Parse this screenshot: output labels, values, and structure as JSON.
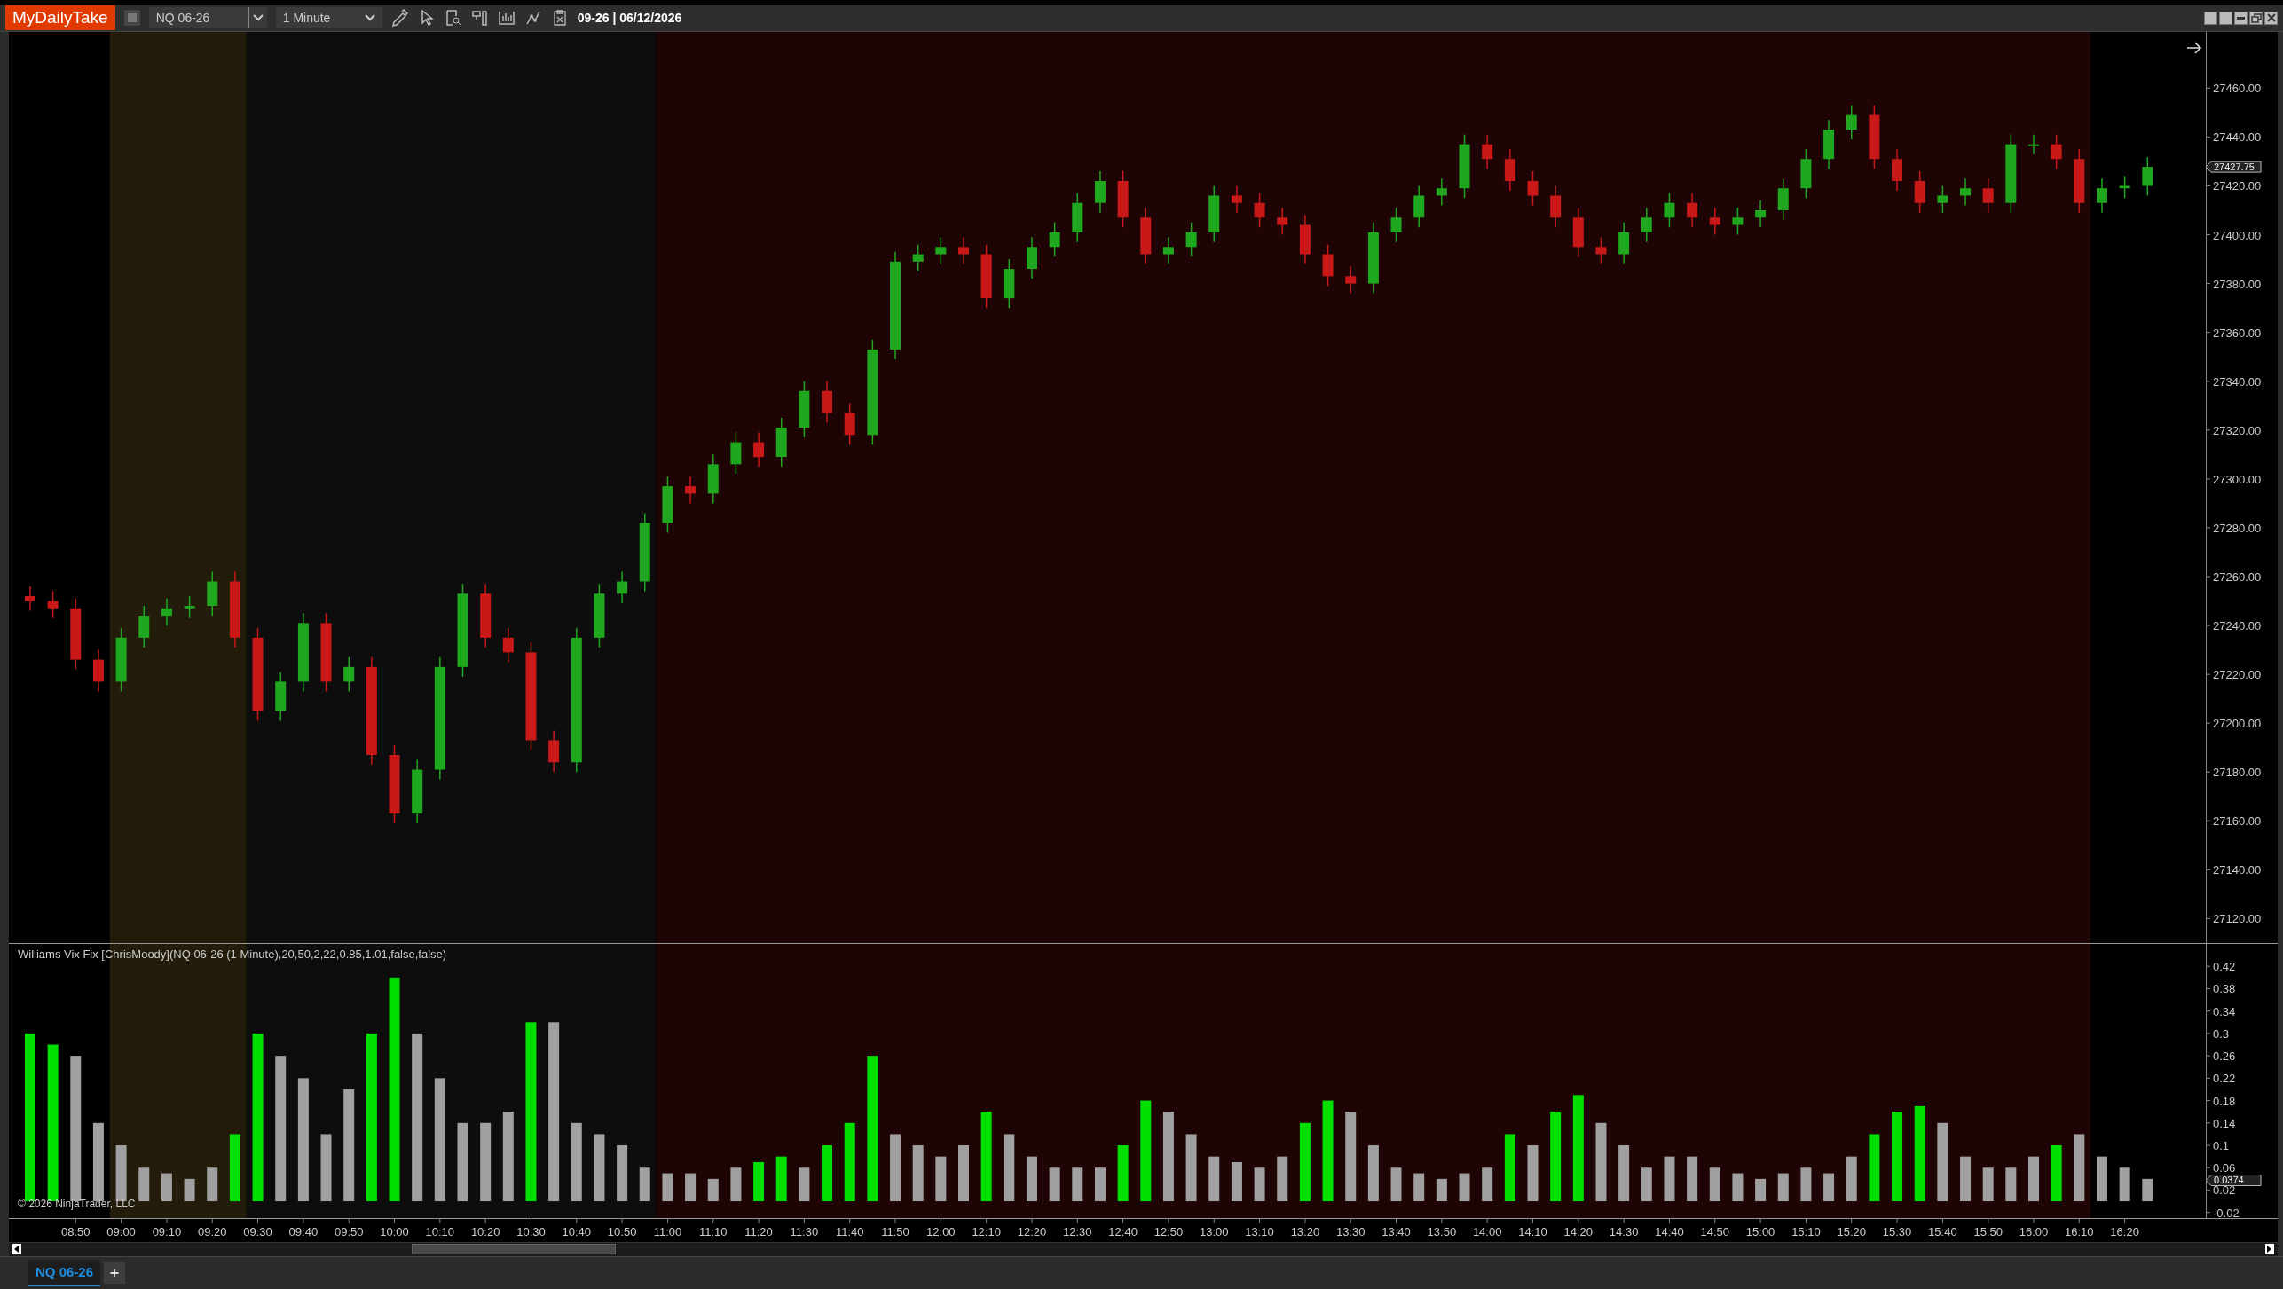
{
  "toolbar": {
    "brand": "MyDailyTake",
    "instrument": "NQ 06-26",
    "interval": "1 Minute",
    "date": "09-26 | 06/12/2026"
  },
  "price_panel": {
    "last_price": "27427.75",
    "chart_data": {
      "type": "candlestick",
      "x": [
        520,
        525,
        530,
        535,
        540,
        545,
        550,
        555,
        560,
        565,
        570,
        575,
        580,
        585,
        590,
        595,
        600,
        605,
        610,
        615,
        620,
        625,
        630,
        635,
        640,
        645,
        650,
        655,
        660,
        665,
        670,
        675,
        680,
        685,
        690,
        695,
        700,
        705,
        710,
        715,
        720,
        725,
        730,
        735,
        740,
        745,
        750,
        755,
        760,
        765,
        770,
        775,
        780,
        785,
        790,
        795,
        800,
        805,
        810,
        815,
        820,
        825,
        830,
        835,
        840,
        845,
        850,
        855,
        860,
        865,
        870,
        875,
        880,
        885,
        890,
        895,
        900,
        905,
        910,
        915,
        920,
        925,
        930,
        935,
        940,
        945,
        950,
        955,
        960,
        965,
        970,
        975,
        980,
        985
      ],
      "ohlc": [
        [
          27252,
          27256,
          27246,
          27250
        ],
        [
          27250,
          27254,
          27243,
          27247
        ],
        [
          27247,
          27251,
          27222,
          27226
        ],
        [
          27226,
          27230,
          27213,
          27217
        ],
        [
          27217,
          27239,
          27213,
          27235
        ],
        [
          27235,
          27248,
          27231,
          27244
        ],
        [
          27244,
          27251,
          27240,
          27247
        ],
        [
          27247,
          27252,
          27243,
          27248
        ],
        [
          27248,
          27262,
          27244,
          27258
        ],
        [
          27258,
          27262,
          27231,
          27235
        ],
        [
          27235,
          27239,
          27201,
          27205
        ],
        [
          27205,
          27221,
          27201,
          27217
        ],
        [
          27217,
          27245,
          27213,
          27241
        ],
        [
          27241,
          27245,
          27213,
          27217
        ],
        [
          27217,
          27227,
          27213,
          27223
        ],
        [
          27223,
          27227,
          27183,
          27187
        ],
        [
          27187,
          27191,
          27159,
          27163
        ],
        [
          27163,
          27185,
          27159,
          27181
        ],
        [
          27181,
          27227,
          27177,
          27223
        ],
        [
          27223,
          27257,
          27219,
          27253
        ],
        [
          27253,
          27257,
          27231,
          27235
        ],
        [
          27235,
          27239,
          27225,
          27229
        ],
        [
          27229,
          27233,
          27189,
          27193
        ],
        [
          27193,
          27197,
          27180,
          27184
        ],
        [
          27184,
          27239,
          27180,
          27235
        ],
        [
          27235,
          27257,
          27231,
          27253
        ],
        [
          27253,
          27262,
          27249,
          27258
        ],
        [
          27258,
          27286,
          27254,
          27282
        ],
        [
          27282,
          27301,
          27278,
          27297
        ],
        [
          27297,
          27301,
          27290,
          27294
        ],
        [
          27294,
          27310,
          27290,
          27306
        ],
        [
          27306,
          27319,
          27302,
          27315
        ],
        [
          27315,
          27319,
          27305,
          27309
        ],
        [
          27309,
          27325,
          27305,
          27321
        ],
        [
          27321,
          27340,
          27317,
          27336
        ],
        [
          27336,
          27340,
          27323,
          27327
        ],
        [
          27327,
          27331,
          27314,
          27318
        ],
        [
          27318,
          27357,
          27314,
          27353
        ],
        [
          27353,
          27393,
          27349,
          27389
        ],
        [
          27389,
          27396,
          27385,
          27392
        ],
        [
          27392,
          27399,
          27388,
          27395
        ],
        [
          27395,
          27399,
          27388,
          27392
        ],
        [
          27392,
          27396,
          27370,
          27374
        ],
        [
          27374,
          27390,
          27370,
          27386
        ],
        [
          27386,
          27399,
          27382,
          27395
        ],
        [
          27395,
          27405,
          27391,
          27401
        ],
        [
          27401,
          27417,
          27397,
          27413
        ],
        [
          27413,
          27426,
          27409,
          27422
        ],
        [
          27422,
          27426,
          27403,
          27407
        ],
        [
          27407,
          27411,
          27388,
          27392
        ],
        [
          27392,
          27399,
          27388,
          27395
        ],
        [
          27395,
          27405,
          27391,
          27401
        ],
        [
          27401,
          27420,
          27397,
          27416
        ],
        [
          27416,
          27420,
          27409,
          27413
        ],
        [
          27413,
          27417,
          27403,
          27407
        ],
        [
          27407,
          27411,
          27400,
          27404
        ],
        [
          27404,
          27408,
          27388,
          27392
        ],
        [
          27392,
          27396,
          27379,
          27383
        ],
        [
          27383,
          27387,
          27376,
          27380
        ],
        [
          27380,
          27405,
          27376,
          27401
        ],
        [
          27401,
          27411,
          27397,
          27407
        ],
        [
          27407,
          27420,
          27403,
          27416
        ],
        [
          27416,
          27423,
          27412,
          27419
        ],
        [
          27419,
          27441,
          27415,
          27437
        ],
        [
          27437,
          27441,
          27427,
          27431
        ],
        [
          27431,
          27435,
          27418,
          27422
        ],
        [
          27422,
          27426,
          27412,
          27416
        ],
        [
          27416,
          27420,
          27403,
          27407
        ],
        [
          27407,
          27411,
          27391,
          27395
        ],
        [
          27395,
          27399,
          27388,
          27392
        ],
        [
          27392,
          27405,
          27388,
          27401
        ],
        [
          27401,
          27411,
          27397,
          27407
        ],
        [
          27407,
          27417,
          27403,
          27413
        ],
        [
          27413,
          27417,
          27403,
          27407
        ],
        [
          27407,
          27411,
          27400,
          27404
        ],
        [
          27404,
          27411,
          27400,
          27407
        ],
        [
          27407,
          27414,
          27403,
          27410
        ],
        [
          27410,
          27423,
          27406,
          27419
        ],
        [
          27419,
          27435,
          27415,
          27431
        ],
        [
          27431,
          27447,
          27427,
          27443
        ],
        [
          27443,
          27453,
          27439,
          27449
        ],
        [
          27449,
          27453,
          27427,
          27431
        ],
        [
          27431,
          27435,
          27418,
          27422
        ],
        [
          27422,
          27426,
          27409,
          27413
        ],
        [
          27413,
          27420,
          27409,
          27416
        ],
        [
          27416,
          27423,
          27412,
          27419
        ],
        [
          27419,
          27423,
          27409,
          27413
        ],
        [
          27413,
          27441,
          27409,
          27437
        ],
        [
          27437,
          27441,
          27433,
          27437
        ],
        [
          27437,
          27441,
          27427,
          27431
        ],
        [
          27431,
          27435,
          27409,
          27413
        ],
        [
          27413,
          27423,
          27409,
          27419
        ],
        [
          27419,
          27424,
          27415,
          27420
        ],
        [
          27420,
          27431.75,
          27416,
          27427.75
        ]
      ],
      "xlim": [
        516.5,
        1013
      ],
      "ylim": [
        27110,
        27483
      ],
      "yticks": [
        {
          "value": 27460,
          "label": "27460.00"
        },
        {
          "value": 27440,
          "label": "27440.00"
        },
        {
          "value": 27420,
          "label": "27420.00"
        },
        {
          "value": 27400,
          "label": "27400.00"
        },
        {
          "value": 27380,
          "label": "27380.00"
        },
        {
          "value": 27360,
          "label": "27360.00"
        },
        {
          "value": 27340,
          "label": "27340.00"
        },
        {
          "value": 27320,
          "label": "27320.00"
        },
        {
          "value": 27300,
          "label": "27300.00"
        },
        {
          "value": 27280,
          "label": "27280.00"
        },
        {
          "value": 27260,
          "label": "27260.00"
        },
        {
          "value": 27240,
          "label": "27240.00"
        },
        {
          "value": 27220,
          "label": "27220.00"
        },
        {
          "value": 27200,
          "label": "27200.00"
        },
        {
          "value": 27180,
          "label": "27180.00"
        },
        {
          "value": 27160,
          "label": "27160.00"
        },
        {
          "value": 27140,
          "label": "27140.00"
        },
        {
          "value": 27120,
          "label": "27120.00"
        }
      ],
      "bands": [
        {
          "axis": "x",
          "from": 537.5,
          "to": 567.5,
          "color": "#231c0b"
        },
        {
          "axis": "x",
          "from": 567.5,
          "to": 657.5,
          "color": "#0d0d0d"
        },
        {
          "axis": "x",
          "from": 657.5,
          "to": 972.5,
          "color": "#1e0404"
        }
      ]
    }
  },
  "indicator_panel": {
    "label": "Williams Vix Fix [ChrisMoody](NQ 06-26 (1 Minute),20,50,2,22,0.85,1.01,false,false)",
    "last_value": "0.0374",
    "copyright": "© 2026 NinjaTrader, LLC",
    "chart_data": {
      "type": "bar",
      "stacked": true,
      "x": [
        520,
        525,
        530,
        535,
        540,
        545,
        550,
        555,
        560,
        565,
        570,
        575,
        580,
        585,
        590,
        595,
        600,
        605,
        610,
        615,
        620,
        625,
        630,
        635,
        640,
        645,
        650,
        655,
        660,
        665,
        670,
        675,
        680,
        685,
        690,
        695,
        700,
        705,
        710,
        715,
        720,
        725,
        730,
        735,
        740,
        745,
        750,
        755,
        760,
        765,
        770,
        775,
        780,
        785,
        790,
        795,
        800,
        805,
        810,
        815,
        820,
        825,
        830,
        835,
        840,
        845,
        850,
        855,
        860,
        865,
        870,
        875,
        880,
        885,
        890,
        895,
        900,
        905,
        910,
        915,
        920,
        925,
        930,
        935,
        940,
        945,
        950,
        955,
        960,
        965,
        970,
        975,
        980,
        985
      ],
      "series": [
        {
          "color": "#a0a0a0",
          "values": [
            null,
            null,
            0.26,
            0.14,
            0.1,
            0.06,
            0.05,
            0.04,
            0.06,
            null,
            null,
            0.26,
            0.22,
            0.12,
            0.2,
            null,
            null,
            0.3,
            0.22,
            0.14,
            0.14,
            0.16,
            null,
            0.32,
            0.14,
            0.12,
            0.1,
            0.06,
            0.05,
            0.05,
            0.04,
            0.06,
            null,
            null,
            0.06,
            null,
            null,
            null,
            0.12,
            0.1,
            0.08,
            0.1,
            null,
            0.12,
            0.08,
            0.06,
            0.06,
            0.06,
            null,
            null,
            0.16,
            0.12,
            0.08,
            0.07,
            0.06,
            0.08,
            null,
            null,
            0.16,
            0.1,
            0.06,
            0.05,
            0.04,
            0.05,
            0.06,
            null,
            0.1,
            null,
            null,
            0.14,
            0.1,
            0.06,
            0.08,
            0.08,
            0.06,
            0.05,
            0.04,
            0.05,
            0.06,
            0.05,
            0.08,
            null,
            null,
            null,
            0.14,
            0.08,
            0.06,
            0.06,
            0.08,
            null,
            0.12,
            0.08,
            0.06,
            0.04
          ]
        },
        {
          "color": "#00e000",
          "values": [
            0.3,
            0.28,
            null,
            null,
            null,
            null,
            null,
            null,
            null,
            0.12,
            0.3,
            null,
            null,
            null,
            null,
            0.3,
            0.4,
            null,
            null,
            null,
            null,
            null,
            0.32,
            null,
            null,
            null,
            null,
            null,
            null,
            null,
            null,
            null,
            0.07,
            0.08,
            null,
            0.1,
            0.14,
            0.26,
            null,
            null,
            null,
            null,
            0.16,
            null,
            null,
            null,
            null,
            null,
            0.1,
            0.18,
            null,
            null,
            null,
            null,
            null,
            null,
            0.14,
            0.18,
            null,
            null,
            null,
            null,
            null,
            null,
            null,
            0.12,
            null,
            0.16,
            0.19,
            null,
            null,
            null,
            null,
            null,
            null,
            null,
            null,
            null,
            null,
            null,
            null,
            0.12,
            0.16,
            0.17,
            null,
            null,
            null,
            null,
            null,
            0.1,
            null,
            null,
            null,
            null
          ]
        }
      ],
      "xlim": [
        516.5,
        1013
      ],
      "ylim": [
        -0.03,
        0.46
      ],
      "bands": [
        {
          "axis": "x",
          "from": 537.5,
          "to": 567.5,
          "color": "#231c0b"
        },
        {
          "axis": "x",
          "from": 567.5,
          "to": 657.5,
          "color": "#0d0d0d"
        },
        {
          "axis": "x",
          "from": 657.5,
          "to": 972.5,
          "color": "#1e0404"
        }
      ],
      "yticks": [
        {
          "value": 0.42,
          "label": "0.42"
        },
        {
          "value": 0.38,
          "label": "0.38"
        },
        {
          "value": 0.34,
          "label": "0.34"
        },
        {
          "value": 0.3,
          "label": "0.3"
        },
        {
          "value": 0.26,
          "label": "0.26"
        },
        {
          "value": 0.22,
          "label": "0.22"
        },
        {
          "value": 0.18,
          "label": "0.18"
        },
        {
          "value": 0.14,
          "label": "0.14"
        },
        {
          "value": 0.1,
          "label": "0.1"
        },
        {
          "value": 0.06,
          "label": "0.06"
        },
        {
          "value": 0.02,
          "label": "0.02"
        },
        {
          "value": -0.02,
          "label": "-0.02"
        }
      ],
      "xticks": [
        {
          "value": 530,
          "label": "08:50"
        },
        {
          "value": 540,
          "label": "09:00"
        },
        {
          "value": 550,
          "label": "09:10"
        },
        {
          "value": 560,
          "label": "09:20"
        },
        {
          "value": 570,
          "label": "09:30"
        },
        {
          "value": 580,
          "label": "09:40"
        },
        {
          "value": 590,
          "label": "09:50"
        },
        {
          "value": 600,
          "label": "10:00"
        },
        {
          "value": 610,
          "label": "10:10"
        },
        {
          "value": 620,
          "label": "10:20"
        },
        {
          "value": 630,
          "label": "10:30"
        },
        {
          "value": 640,
          "label": "10:40"
        },
        {
          "value": 650,
          "label": "10:50"
        },
        {
          "value": 660,
          "label": "11:00"
        },
        {
          "value": 670,
          "label": "11:10"
        },
        {
          "value": 680,
          "label": "11:20"
        },
        {
          "value": 690,
          "label": "11:30"
        },
        {
          "value": 700,
          "label": "11:40"
        },
        {
          "value": 710,
          "label": "11:50"
        },
        {
          "value": 720,
          "label": "12:00"
        },
        {
          "value": 730,
          "label": "12:10"
        },
        {
          "value": 740,
          "label": "12:20"
        },
        {
          "value": 750,
          "label": "12:30"
        },
        {
          "value": 760,
          "label": "12:40"
        },
        {
          "value": 770,
          "label": "12:50"
        },
        {
          "value": 780,
          "label": "13:00"
        },
        {
          "value": 790,
          "label": "13:10"
        },
        {
          "value": 800,
          "label": "13:20"
        },
        {
          "value": 810,
          "label": "13:30"
        },
        {
          "value": 820,
          "label": "13:40"
        },
        {
          "value": 830,
          "label": "13:50"
        },
        {
          "value": 840,
          "label": "14:00"
        },
        {
          "value": 850,
          "label": "14:10"
        },
        {
          "value": 860,
          "label": "14:20"
        },
        {
          "value": 870,
          "label": "14:30"
        },
        {
          "value": 880,
          "label": "14:40"
        },
        {
          "value": 890,
          "label": "14:50"
        },
        {
          "value": 900,
          "label": "15:00"
        },
        {
          "value": 910,
          "label": "15:10"
        },
        {
          "value": 920,
          "label": "15:20"
        },
        {
          "value": 930,
          "label": "15:30"
        },
        {
          "value": 940,
          "label": "15:40"
        },
        {
          "value": 950,
          "label": "15:50"
        },
        {
          "value": 960,
          "label": "16:00"
        },
        {
          "value": 970,
          "label": "16:10"
        },
        {
          "value": 980,
          "label": "16:20"
        }
      ]
    }
  },
  "tabs": [
    {
      "label": "NQ 06-26",
      "selected": true
    }
  ],
  "add_tab": "+"
}
